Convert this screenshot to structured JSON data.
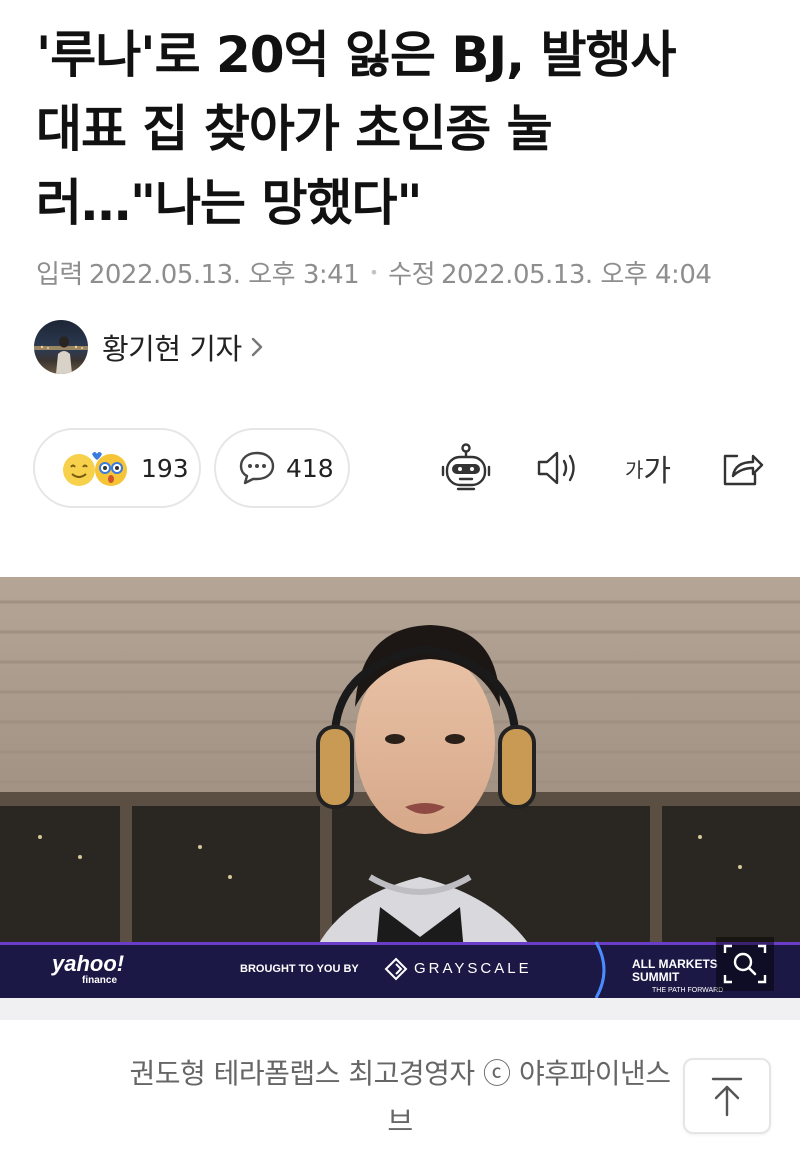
{
  "article": {
    "title_lines": [
      "'루나'로 20억 잃은 BJ, 발행사",
      "대표 집 찾아가 초인종 눌",
      "러…\"나는 망했다\""
    ],
    "published_label": "입력",
    "published": "2022.05.13. 오후 3:41",
    "modified_label": "수정",
    "modified": "2022.05.13. 오후 4:04",
    "separator": "•"
  },
  "reporter": {
    "name": "황기현 기자",
    "avatar_icon": "reporter-photo"
  },
  "actions": {
    "reactions_count": "193",
    "comments_count": "418",
    "font_size_label_small": "가",
    "font_size_label_large": "가",
    "icons": [
      "reaction-emoji-icon",
      "comment-icon",
      "robot-summary-icon",
      "speaker-icon",
      "font-size-icon",
      "share-icon"
    ]
  },
  "video": {
    "banner_logo": "yahoo!",
    "banner_logo_sub": "finance",
    "banner_sponsor_label": "BROUGHT TO YOU BY",
    "banner_sponsor": "GRAYSCALE",
    "banner_event_line1": "ALL MARKETS",
    "banner_event_line2": "SUMMIT",
    "banner_event_line3": "THE PATH FORWARD",
    "colors": {
      "banner_bg": "#1c1845",
      "banner_accent": "#6a3cc9"
    }
  },
  "caption": {
    "line1": "권도형 테라폼랩스 최고경영자 ⓒ 야후파이낸스",
    "line2": "브"
  }
}
